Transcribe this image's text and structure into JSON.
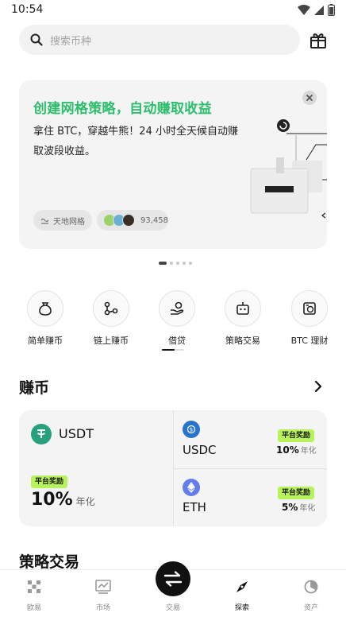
{
  "status_bar": {
    "time": "10:54"
  },
  "search": {
    "placeholder": "搜索币种"
  },
  "banner": {
    "title": "创建网格策略，自动赚取收益",
    "description": "拿住 BTC，穿越牛熊！24 小时全天候自动赚取波段收益。",
    "tag_strategy": "天地网格",
    "tag_users_count": "93,458"
  },
  "shortcuts": [
    {
      "label": "简单赚币",
      "icon": "money-bag-icon"
    },
    {
      "label": "链上赚币",
      "icon": "chain-nodes-icon"
    },
    {
      "label": "借贷",
      "icon": "hand-coin-icon"
    },
    {
      "label": "策略交易",
      "icon": "robot-icon"
    },
    {
      "label": "BTC 理财",
      "icon": "btc-vault-icon"
    }
  ],
  "earn": {
    "title": "赚币",
    "badge": "平台奖励",
    "apy_suffix": "年化",
    "usdt": {
      "name": "USDT",
      "rate": "10%",
      "color": "#26a17b"
    },
    "usdc": {
      "name": "USDC",
      "rate": "10%",
      "color": "#2775ca"
    },
    "eth": {
      "name": "ETH",
      "rate": "5%",
      "color": "#627eea"
    }
  },
  "strategy": {
    "title": "策略交易"
  },
  "nav": {
    "items": [
      {
        "label": "欧易",
        "icon": "okx-logo-icon"
      },
      {
        "label": "市场",
        "icon": "market-chart-icon"
      },
      {
        "label": "交易",
        "icon": "swap-arrows-icon"
      },
      {
        "label": "探索",
        "icon": "compass-icon"
      },
      {
        "label": "资产",
        "icon": "pie-chart-icon"
      }
    ]
  },
  "colors": {
    "accent_green": "#2dbe6c",
    "badge_lime": "#b8f25c",
    "card_bg": "#f4f4f4"
  }
}
